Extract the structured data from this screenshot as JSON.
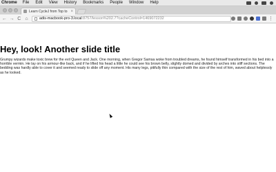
{
  "menubar": {
    "app_name": "Chrome",
    "items": [
      "File",
      "Edit",
      "View",
      "History",
      "Bookmarks",
      "People",
      "Window",
      "Help"
    ]
  },
  "tab": {
    "title": "Learn CycleJ from Top to",
    "close_glyph": "×"
  },
  "toolbar": {
    "back_glyph": "←",
    "forward_glyph": "→",
    "reload_glyph": "C",
    "home_glyph": "⌂",
    "menu_glyph": "⋮",
    "url_host": "adis-macbook-pro-3.local",
    "url_rest": ":8757/lesson%202.7?cacheControl=1469072232"
  },
  "page": {
    "heading": "Hey, look! Another slide title",
    "paragraph": "Grumpy wizards make toxic brew for the evil Queen and Jack. One morning, when Gregor Samsa woke from troubled dreams, he found himself transformed in his bed into a horrible vermin. He lay on his armour-like back, and if he lifted his head a little he could see his brown belly, slightly domed and divided by arches into stiff sections. The bedding was hardly able to cover it and seemed ready to slide off any moment. His many legs, pitifully thin compared with the size of the rest of him, waved about helplessly as he looked."
  }
}
